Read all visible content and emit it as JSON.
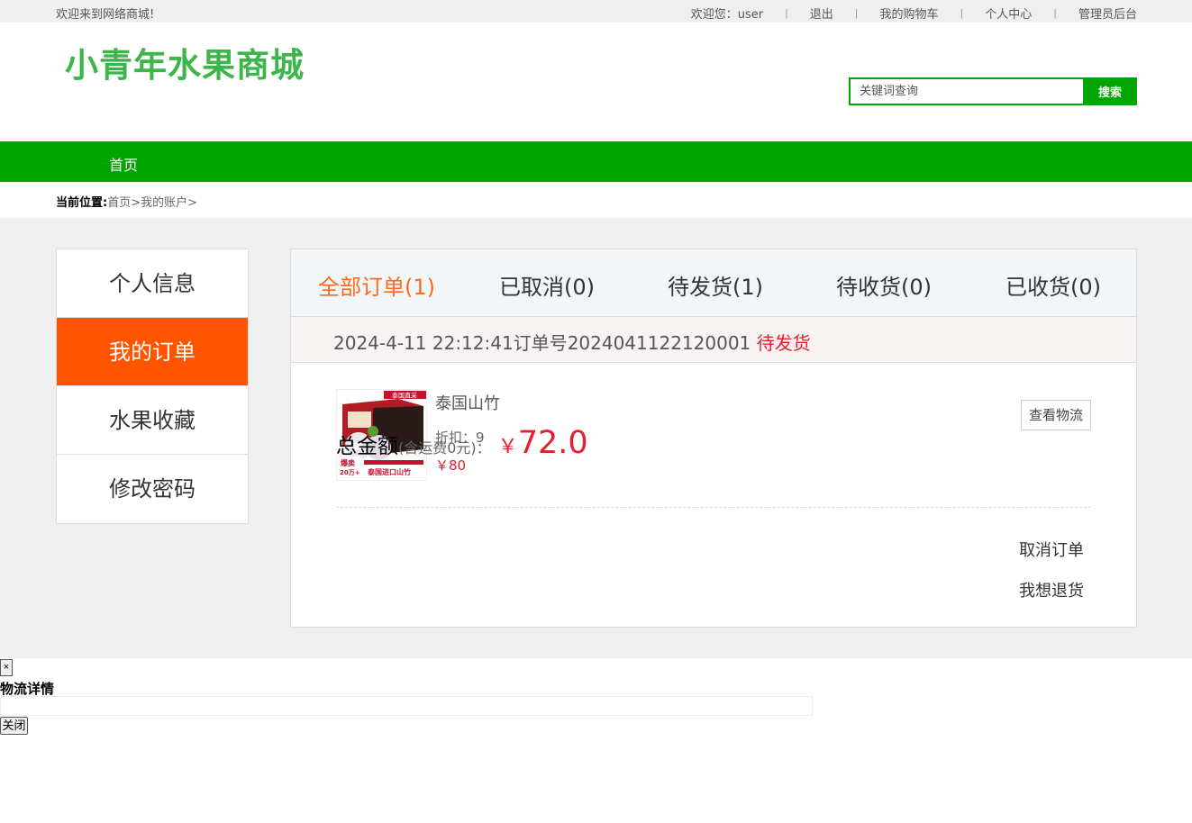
{
  "topbar": {
    "welcome": "欢迎来到网络商城!",
    "user_greeting": "欢迎您：user",
    "logout": "退出",
    "cart": "我的购物车",
    "profile": "个人中心",
    "admin": "管理员后台"
  },
  "header": {
    "logo": "小青年水果商城",
    "search_placeholder": "关键词查询",
    "search_button": "搜索"
  },
  "nav": {
    "home": "首页"
  },
  "breadcrumb": {
    "label": "当前位置:",
    "home": "首页",
    "account": "我的账户"
  },
  "sidebar": {
    "items": [
      {
        "label": "个人信息"
      },
      {
        "label": "我的订单",
        "active": true
      },
      {
        "label": "水果收藏"
      },
      {
        "label": "修改密码"
      }
    ]
  },
  "tabs": [
    {
      "label": "全部订单(1)",
      "active": true
    },
    {
      "label": "已取消(0)"
    },
    {
      "label": "待发货(1)"
    },
    {
      "label": "待收货(0)"
    },
    {
      "label": "已收货(0)"
    }
  ],
  "order": {
    "datetime": "2024-4-11 22:12:41",
    "number_label": "订单号",
    "number": "2024041122120001",
    "status": "待发货",
    "product": {
      "name": "泰国山竹",
      "discount_label": "折扣：",
      "discount": "9",
      "price": "￥80",
      "image_texts": [
        "泰国直采",
        "爆卖",
        "20万+",
        "泰国进口山竹"
      ]
    },
    "logistics_button": "查看物流",
    "total_label": "总金额",
    "total_note": "(含运费0元)：",
    "currency": "￥",
    "total_amount": "72.0",
    "cancel_action": "取消订单",
    "return_action": "我想退货"
  },
  "modal": {
    "close_symbol": "×",
    "title": "物流详情",
    "close_button": "关闭"
  },
  "colors": {
    "brand_green": "#00a502",
    "logo_green": "#3cb54a",
    "active_orange": "#ff5500",
    "tab_active": "#ff6a1a",
    "price_red": "#e4202e"
  }
}
